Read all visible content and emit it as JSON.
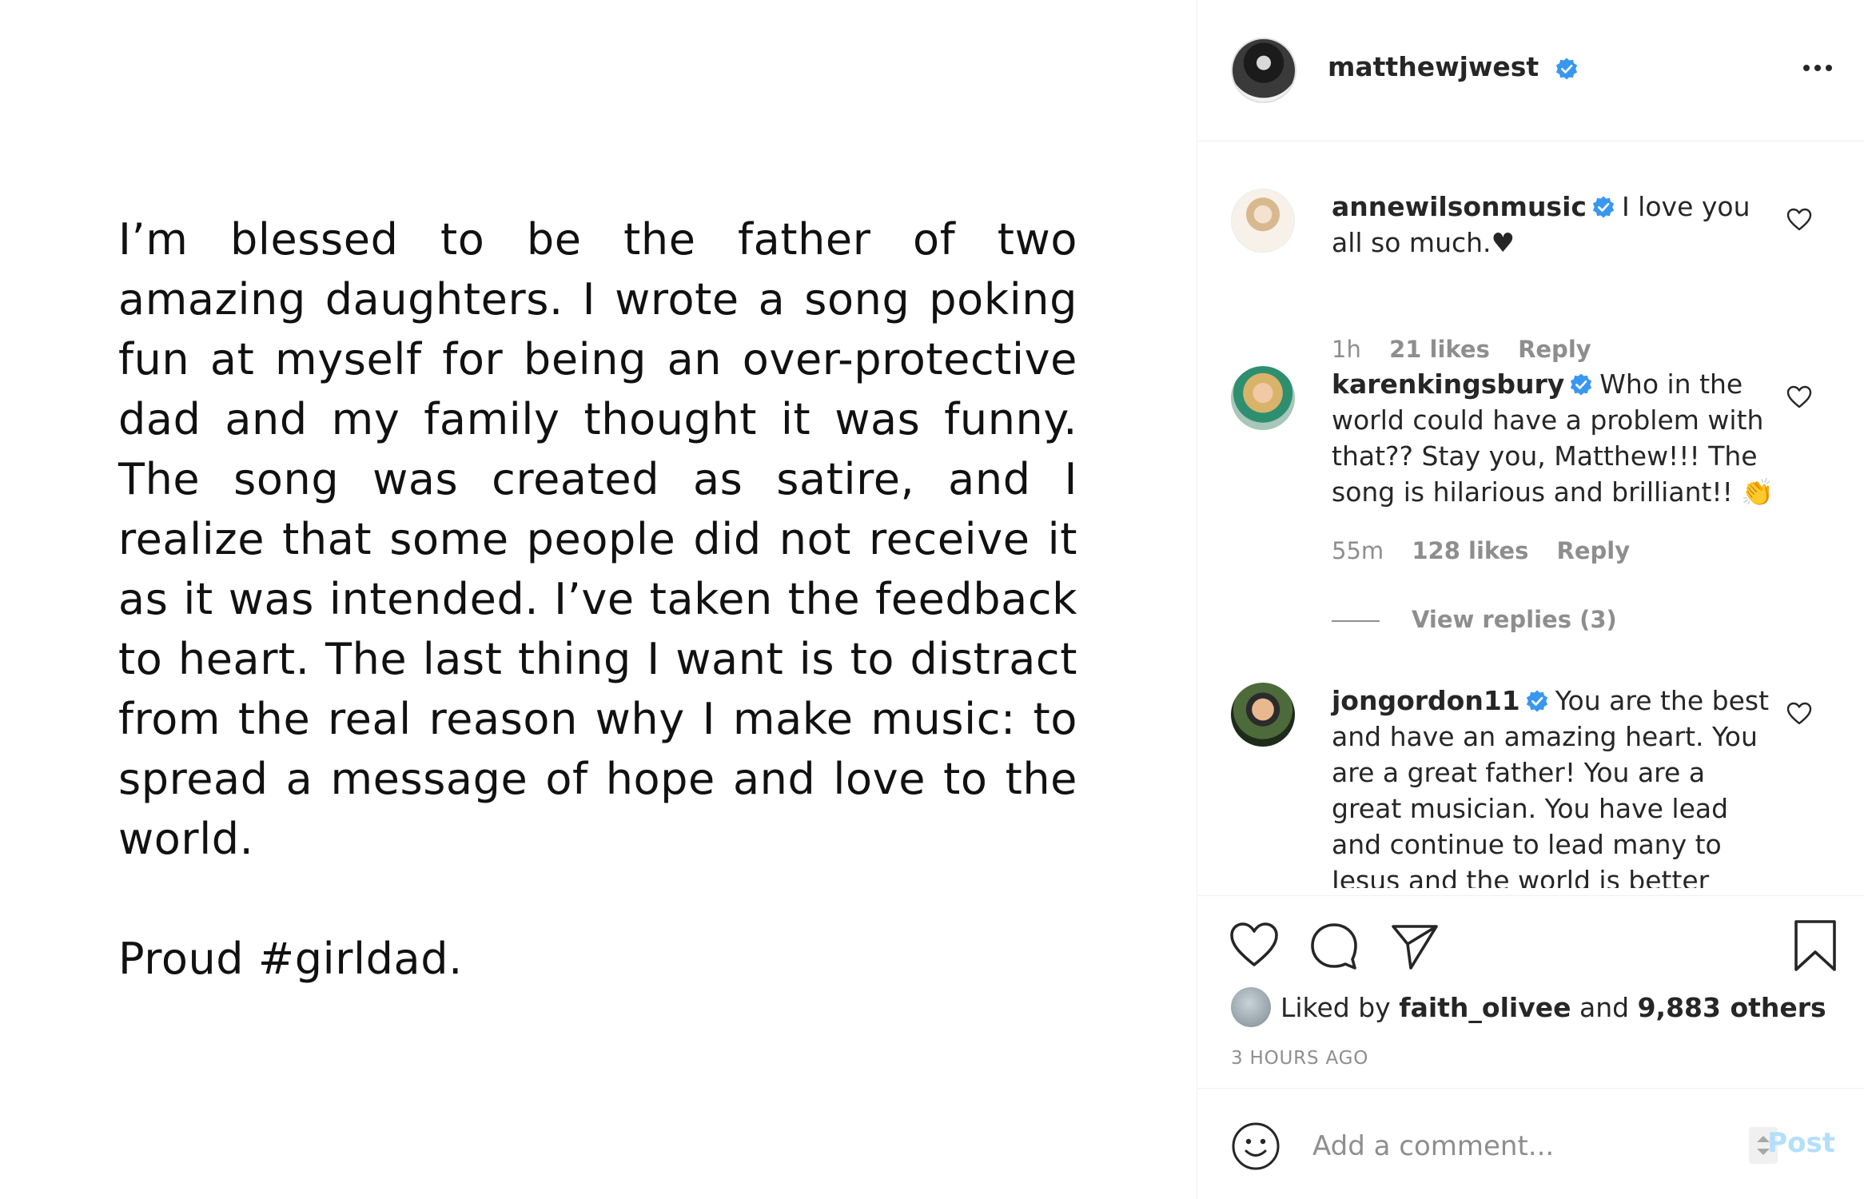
{
  "post": {
    "text": "I’m blessed to be the father of two amazing daughters. I wrote a song poking fun at myself for being an over-protective dad and my family thought it was funny. The song was created as satire, and I realize that some people did not receive it as it was intended. I’ve taken the feedback to heart. The last thing I want is to distract from the real reason why I make music: to spread a message of hope and love to the world.",
    "signoff": "Proud #girldad."
  },
  "header": {
    "username": "matthewjwest"
  },
  "comments": [
    {
      "username": "annewilsonmusic",
      "text": "I love you all so much.♥",
      "time": "1h",
      "likes": "21 likes",
      "reply": "Reply"
    },
    {
      "username": "karenkingsbury",
      "text": "Who in the world could have a problem with that?? Stay you, Matthew!!! The song is hilarious and brilliant!! 👏",
      "time": "55m",
      "likes": "128 likes",
      "reply": "Reply",
      "view_replies": "View replies (3)"
    },
    {
      "username": "jongordon11",
      "text": "You are the best and have an amazing heart. You are a great father! You are a great musician. You have lead and continue to lead many to Jesus and the world is better because of"
    }
  ],
  "likes": {
    "prefix": "Liked by",
    "user": "faith_olivee",
    "conjunction": "and",
    "others": "9,883 others"
  },
  "timestamp": "3 HOURS AGO",
  "add_comment": {
    "placeholder": "Add a comment...",
    "post_label": "Post"
  },
  "colors": {
    "verified": "#3897f0",
    "muted": "#8e8e8e",
    "post_disabled": "#b2dffc"
  }
}
